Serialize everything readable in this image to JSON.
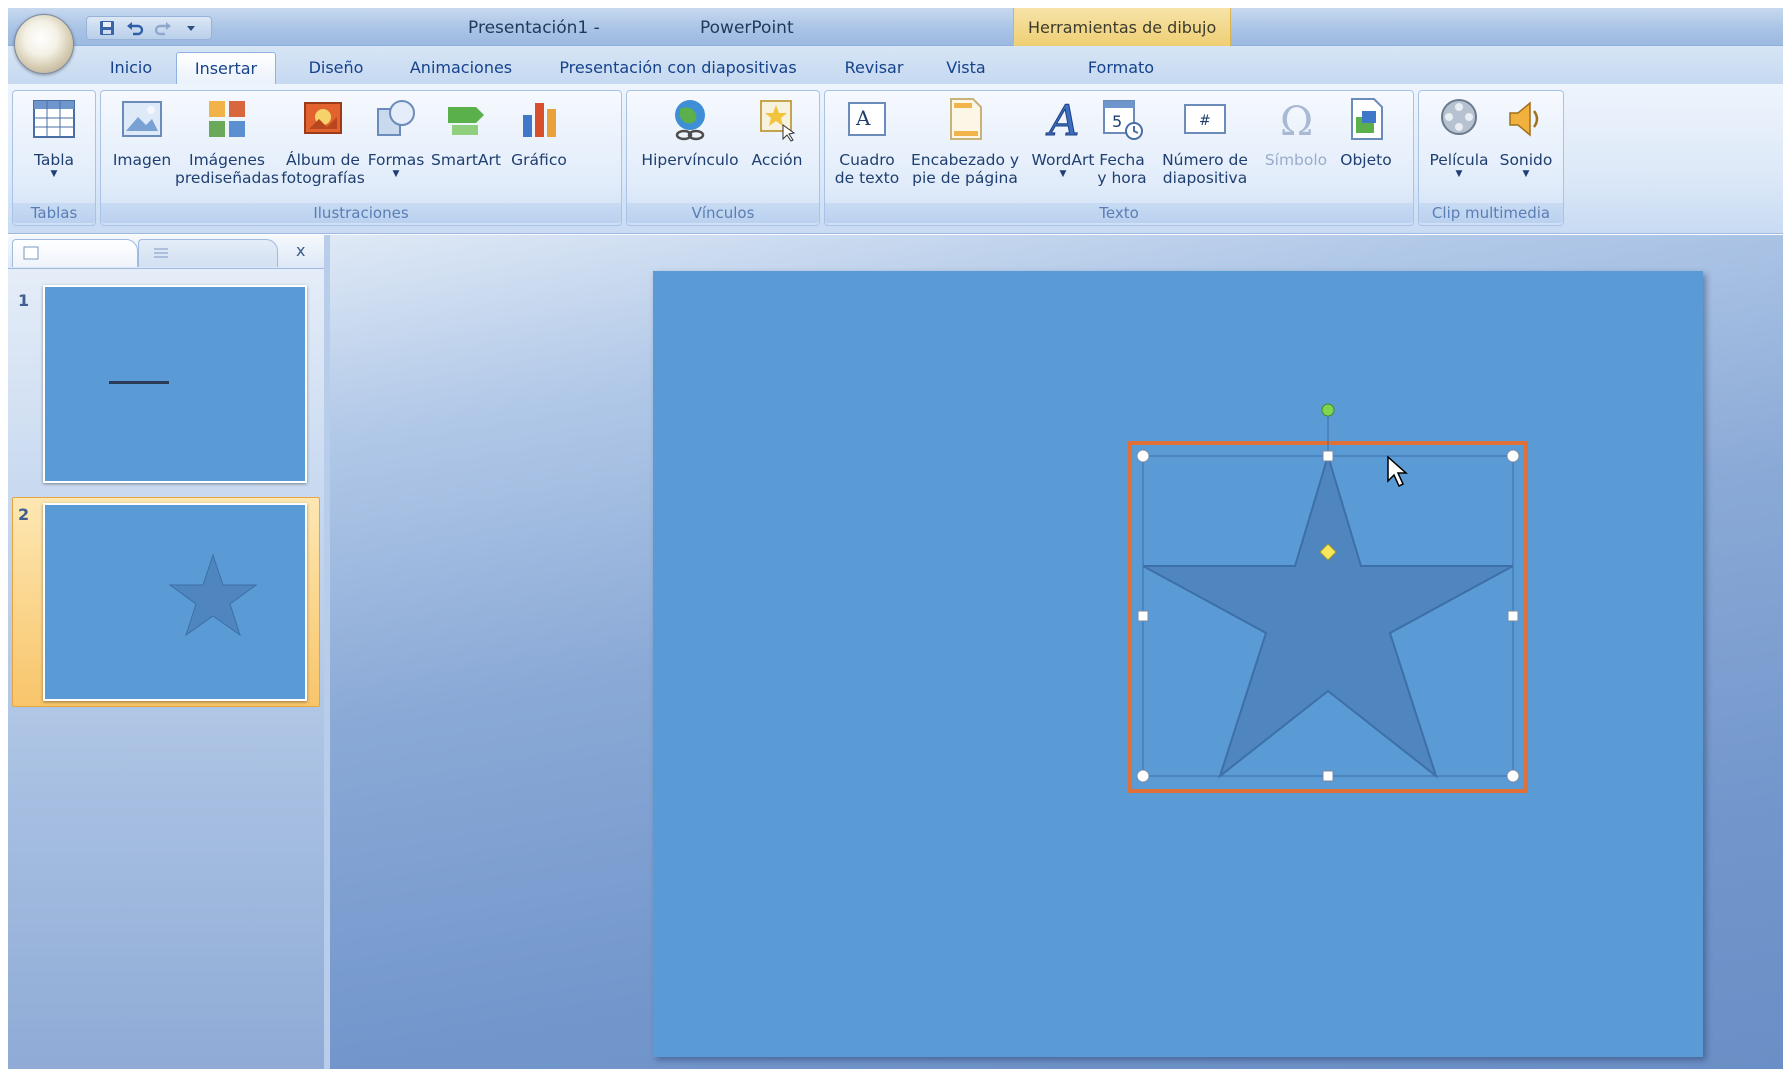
{
  "window": {
    "title_document": "Presentación1 -",
    "title_app": "PowerPoint",
    "contextual_tools_label": "Herramientas de dibujo"
  },
  "quick_access": [
    "save-icon",
    "undo-icon",
    "redo-icon",
    "customize-icon"
  ],
  "tabs": [
    {
      "label": "Inicio",
      "active": false
    },
    {
      "label": "Insertar",
      "active": true
    },
    {
      "label": "Diseño",
      "active": false
    },
    {
      "label": "Animaciones",
      "active": false
    },
    {
      "label": "Presentación con diapositivas",
      "active": false
    },
    {
      "label": "Revisar",
      "active": false
    },
    {
      "label": "Vista",
      "active": false
    },
    {
      "label": "Formato",
      "active": false
    }
  ],
  "ribbon": {
    "groups": {
      "tablas": "Tablas",
      "ilustraciones": "Ilustraciones",
      "vinculos": "Vínculos",
      "texto": "Texto",
      "clip": "Clip multimedia"
    },
    "buttons": {
      "tabla": "Tabla",
      "imagen": "Imagen",
      "imagenes_1": "Imágenes",
      "imagenes_2": "prediseñadas",
      "album_1": "Álbum de",
      "album_2": "fotografías",
      "formas": "Formas",
      "smartart": "SmartArt",
      "grafico": "Gráfico",
      "hipervinculo": "Hipervínculo",
      "accion": "Acción",
      "cuadro_1": "Cuadro",
      "cuadro_2": "de texto",
      "encabezado_1": "Encabezado y",
      "encabezado_2": "pie de página",
      "wordart": "WordArt",
      "fecha_1": "Fecha",
      "fecha_2": "y hora",
      "numero_1": "Número de",
      "numero_2": "diapositiva",
      "simbolo": "Símbolo",
      "objeto": "Objeto",
      "pelicula": "Película",
      "sonido": "Sonido"
    }
  },
  "slides_pane": {
    "close_glyph": "x",
    "slides": [
      {
        "number": "1",
        "selected": false
      },
      {
        "number": "2",
        "selected": true
      }
    ]
  },
  "slide": {
    "background": "#5b9bd5",
    "shape": "five-point-star",
    "shape_fill": "#4f86c0",
    "selection_color": "#e0703a"
  }
}
